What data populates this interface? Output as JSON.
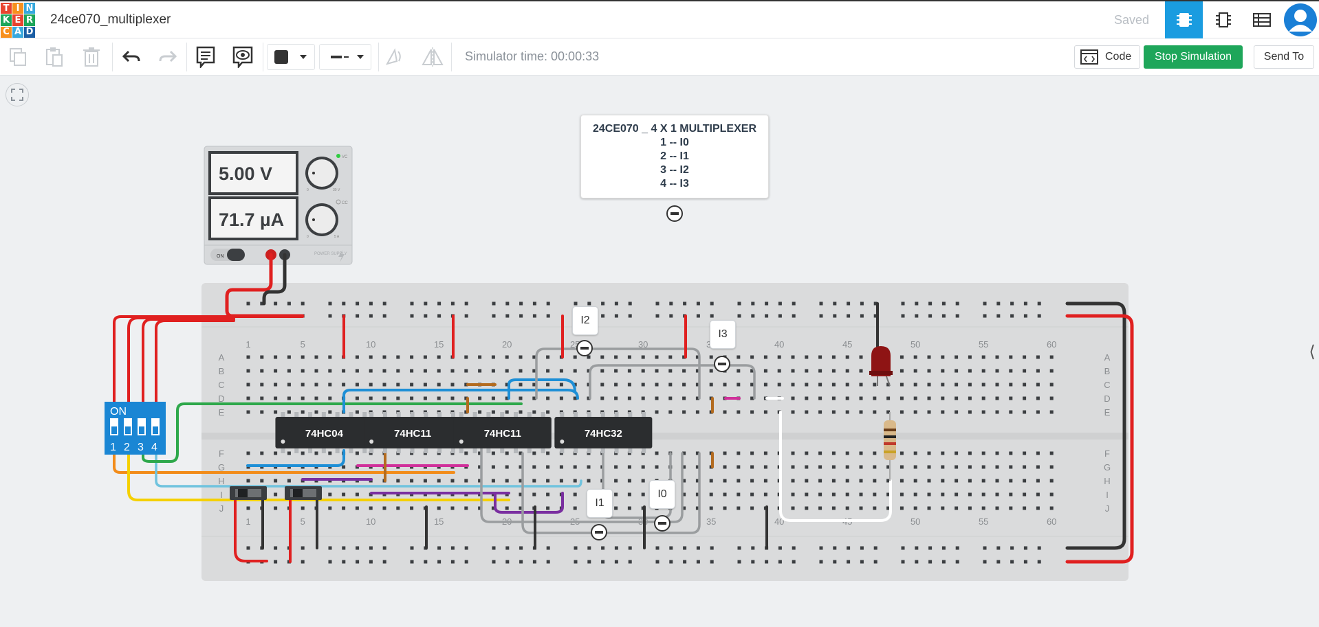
{
  "app": {
    "logo_letters": [
      "T",
      "I",
      "N",
      "K",
      "E",
      "R",
      "C",
      "A",
      "D"
    ],
    "logo_colors": [
      "#e8442f",
      "#f7901e",
      "#37a8dd",
      "#1ea65a",
      "#e8442f",
      "#1ea65a",
      "#f7901e",
      "#37a8dd",
      "#1c5fa5"
    ],
    "project_title": "24ce070_multiplexer",
    "save_status": "Saved",
    "view_icons": [
      "circuit-view-icon",
      "schematic-view-icon",
      "component-list-icon"
    ],
    "user_avatar": "avatar"
  },
  "toolbar": {
    "tools": [
      "copy-icon",
      "paste-icon",
      "delete-icon",
      "undo-icon",
      "redo-icon",
      "notes-icon",
      "notes-visibility-icon",
      "color-swatch-icon",
      "wire-style-icon",
      "rotate-icon",
      "flip-icon"
    ],
    "simulator_time": "Simulator time: 00:00:33",
    "code_label": "Code",
    "stop_label": "Stop Simulation",
    "send_label": "Send To",
    "accent": "#1ea65a"
  },
  "power_supply": {
    "voltage": "5.00 V",
    "current": "71.7 µA",
    "switch_label": "ON",
    "cv_label": "VC",
    "cc_label": "CC",
    "brand": "POWER SUPPLY",
    "voltage_knob_range": [
      "0",
      "30 V"
    ],
    "current_knob_range": [
      "0",
      "5 A"
    ]
  },
  "note": {
    "title": "24CE070 _ 4 X 1 MULTIPLEXER",
    "lines": [
      "1 -- I0",
      "2 -- I1",
      "3 -- I2",
      "4 -- I3"
    ]
  },
  "labels": [
    "I2",
    "I3",
    "I1",
    "I0"
  ],
  "dip_switch": {
    "label": "ON",
    "numbers": [
      "1",
      "2",
      "3",
      "4"
    ]
  },
  "chips": [
    "74HC04",
    "74HC11",
    "74HC11",
    "74HC32"
  ],
  "breadboard": {
    "column_numbers_top": [
      "1",
      "5",
      "10",
      "15",
      "20",
      "25",
      "30",
      "35",
      "40",
      "45",
      "50",
      "55",
      "60"
    ],
    "column_numbers_bottom": [
      "1",
      "5",
      "10",
      "15",
      "20",
      "25",
      "30",
      "35",
      "40",
      "45",
      "50",
      "55",
      "60"
    ],
    "row_letters_top": [
      "A",
      "B",
      "C",
      "D",
      "E"
    ],
    "row_letters_bottom": [
      "F",
      "G",
      "H",
      "I",
      "J"
    ]
  },
  "icons": {
    "expand": "expand-icon",
    "side_handle": "chevron-left-icon",
    "side_handle_glyph": "⟨"
  }
}
